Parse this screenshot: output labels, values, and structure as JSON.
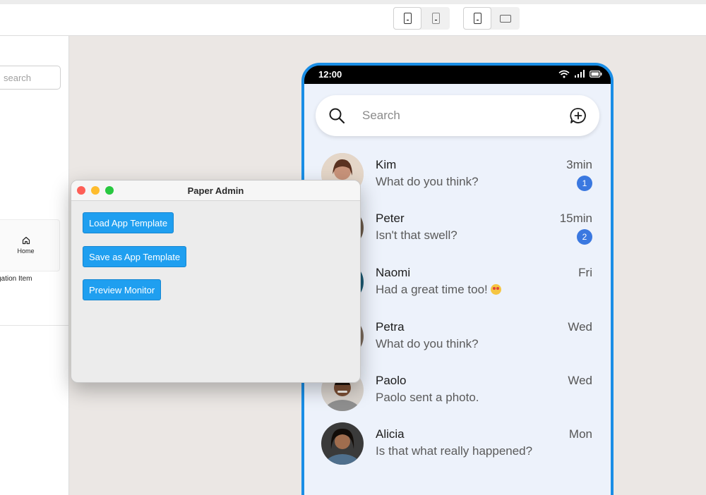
{
  "left_panel": {
    "search_placeholder": "search",
    "home_label": "Home",
    "nav_item_label": "gation Item"
  },
  "phone": {
    "status_time": "12:00",
    "search_placeholder": "Search",
    "conversations": [
      {
        "name": "Kim",
        "message": "What do you think?",
        "time": "3min",
        "badge": "1"
      },
      {
        "name": "Peter",
        "message": "Isn't that swell?",
        "time": "15min",
        "badge": "2"
      },
      {
        "name": "Naomi",
        "message": "Had a great time too!",
        "time": "Fri",
        "badge": ""
      },
      {
        "name": "Petra",
        "message": "What do you think?",
        "time": "Wed",
        "badge": ""
      },
      {
        "name": "Paolo",
        "message": "Paolo sent a photo.",
        "time": "Wed",
        "badge": ""
      },
      {
        "name": "Alicia",
        "message": "Is that what really happened?",
        "time": "Mon",
        "badge": ""
      }
    ]
  },
  "dialog": {
    "title": "Paper Admin",
    "load_label": "Load App Template",
    "save_label": "Save as App Template",
    "preview_label": "Preview Monitor"
  },
  "colors": {
    "phone_border": "#1a8ee6",
    "button_blue": "#1f9ff0",
    "badge_blue": "#3a78e0"
  }
}
